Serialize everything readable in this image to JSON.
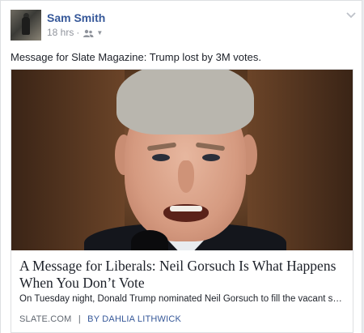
{
  "post": {
    "author": "Sam Smith",
    "time": "18 hrs",
    "separator": "·",
    "audience_icon": "friends-icon",
    "text": "Message for Slate Magazine: Trump lost by 3M votes."
  },
  "link": {
    "title": "A Message for Liberals: Neil Gorsuch Is What Happens When You Don’t Vote",
    "description": "On Tuesday night, Donald Trump nominated Neil Gorsuch to fill the vacant seat on the U.S....",
    "source": "SLATE.COM",
    "source_separator": "|",
    "byline": "BY DAHLIA LITHWICK"
  },
  "colors": {
    "link_blue": "#365899",
    "meta_gray": "#90949c",
    "text": "#1d2129"
  }
}
